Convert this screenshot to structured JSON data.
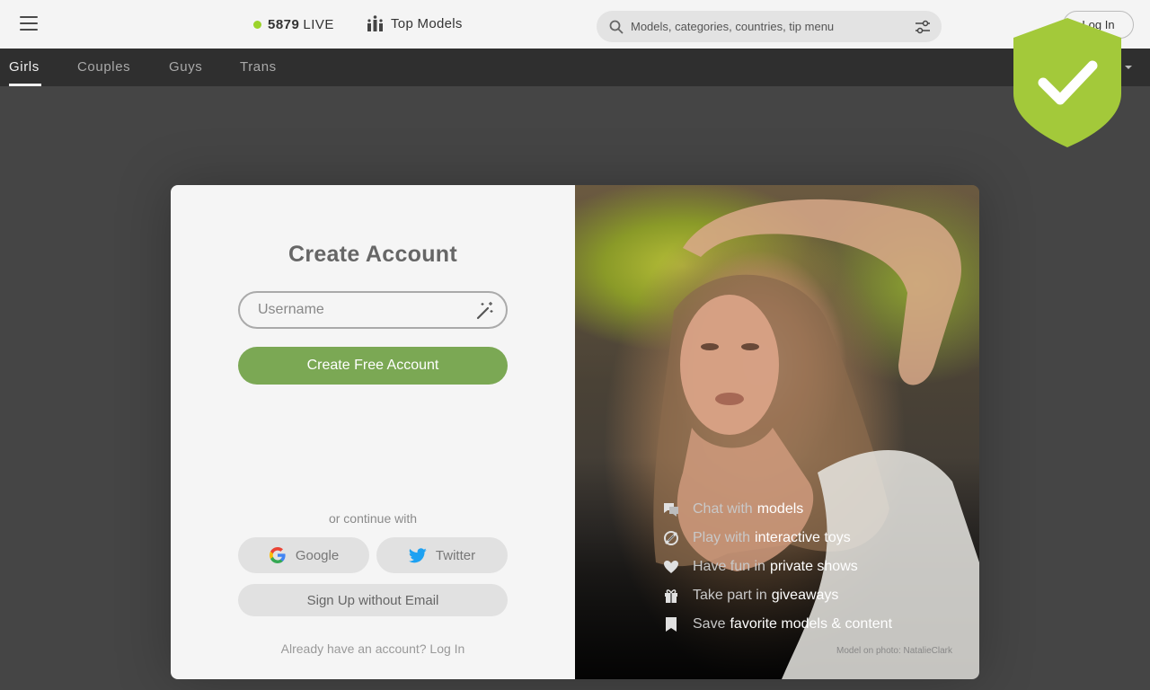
{
  "header": {
    "live_count": "5879",
    "live_label": "LIVE",
    "top_models_label": "Top Models",
    "search_placeholder": "Models, categories, countries, tip menu",
    "login_label": "Log In"
  },
  "categories": {
    "items": [
      "Girls",
      "Couples",
      "Guys",
      "Trans"
    ],
    "active": "Girls"
  },
  "modal": {
    "title": "Create Account",
    "username_placeholder": "Username",
    "create_button": "Create Free Account",
    "or_text": "or continue with",
    "google_label": "Google",
    "twitter_label": "Twitter",
    "no_email_label": "Sign Up without Email",
    "already_text": "Already have an account?",
    "login_link": "Log In"
  },
  "features": [
    {
      "icon": "chat-icon",
      "pre": "Chat with",
      "bold": "models"
    },
    {
      "icon": "toys-icon",
      "pre": "Play with",
      "bold": "interactive toys"
    },
    {
      "icon": "heart-icon",
      "pre": "Have fun in",
      "bold": "private shows"
    },
    {
      "icon": "gift-icon",
      "pre": "Take part in",
      "bold": "giveaways"
    },
    {
      "icon": "bookmark-icon",
      "pre": "Save",
      "bold": "favorite models & content"
    }
  ],
  "photo_credit": "Model on photo: NatalieClark",
  "colors": {
    "accent_green": "#7ba854",
    "live_dot": "#9bd32a",
    "shield_green": "#a3c93a"
  }
}
